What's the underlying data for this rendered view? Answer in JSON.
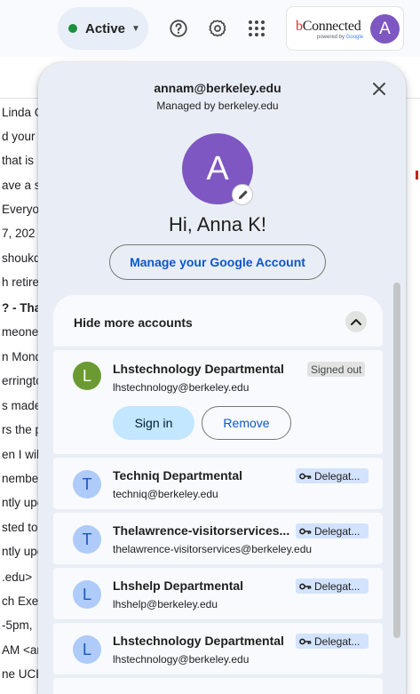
{
  "topbar": {
    "status_label": "Active",
    "status_color": "#1e8e3e",
    "icons": [
      "help-icon",
      "settings-gear-icon",
      "apps-grid-icon"
    ],
    "brand": {
      "name_b": "b",
      "name_rest": "Connected",
      "sub_prefix": "powered by",
      "sub_brand": "Google"
    },
    "avatar_letter": "A"
  },
  "background": {
    "lines": [
      {
        "text": "Linda C",
        "bold": false
      },
      {
        "text": "d your t",
        "bold": false
      },
      {
        "text": "that is",
        "bold": false
      },
      {
        "text": "ave a s",
        "bold": false
      },
      {
        "text": "Everyo",
        "bold": false
      },
      {
        "text": "7, 202",
        "bold": false
      },
      {
        "text": "shoukd",
        "bold": false
      },
      {
        "text": "h retire",
        "bold": false
      },
      {
        "text": "? - Tha",
        "bold": true
      },
      {
        "text": "meone t",
        "bold": false
      },
      {
        "text": "n Mond",
        "bold": false
      },
      {
        "text": "erringto",
        "bold": false
      },
      {
        "text": "s made",
        "bold": false
      },
      {
        "text": "rs the p",
        "bold": false
      },
      {
        "text": "en I will",
        "bold": false
      },
      {
        "text": "nember",
        "bold": false
      },
      {
        "text": "ntly upc",
        "bold": false
      },
      {
        "text": "sted to",
        "bold": false
      },
      {
        "text": "ntly upc",
        "bold": false
      },
      {
        "text": ".edu>",
        "bold": false
      },
      {
        "text": "ch Exec",
        "bold": false
      },
      {
        "text": "-5pm,",
        "bold": false
      },
      {
        "text": "AM <ar",
        "bold": false
      },
      {
        "text": "ne UCB c",
        "bold": false
      }
    ]
  },
  "panel": {
    "email": "annam@berkeley.edu",
    "managed_by": "Managed by berkeley.edu",
    "avatar_letter": "A",
    "greeting": "Hi, Anna K!",
    "manage_label": "Manage your Google Account",
    "accounts_header": "Hide more accounts",
    "signed_out_account": {
      "avatar_letter": "L",
      "name": "Lhstechnology Departmental",
      "email": "lhstechnology@berkeley.edu",
      "badge": "Signed out",
      "signin_label": "Sign in",
      "remove_label": "Remove"
    },
    "accounts": [
      {
        "avatar_letter": "T",
        "name": "Techniq Departmental",
        "email": "techniq@berkeley.edu",
        "badge": "Delegat..."
      },
      {
        "avatar_letter": "T",
        "name": "Thelawrence-visitorservices...",
        "email": "thelawrence-visitorservices@berkeley.edu",
        "badge": "Delegat..."
      },
      {
        "avatar_letter": "L",
        "name": "Lhshelp Departmental",
        "email": "lhshelp@berkeley.edu",
        "badge": "Delegat..."
      },
      {
        "avatar_letter": "L",
        "name": "Lhstechnology Departmental",
        "email": "lhstechnology@berkeley.edu",
        "badge": "Delegat..."
      }
    ]
  },
  "colors": {
    "panel_bg": "#e9eef6",
    "card_bg": "#f8fafd",
    "primary_blue": "#0b57d0",
    "avatar_purple": "#7e57c2",
    "avatar_green": "#6c9a32",
    "avatar_blue": "#aecbfa",
    "delegated_badge": "#d3e3fd",
    "signin_button": "#c2e7ff"
  }
}
